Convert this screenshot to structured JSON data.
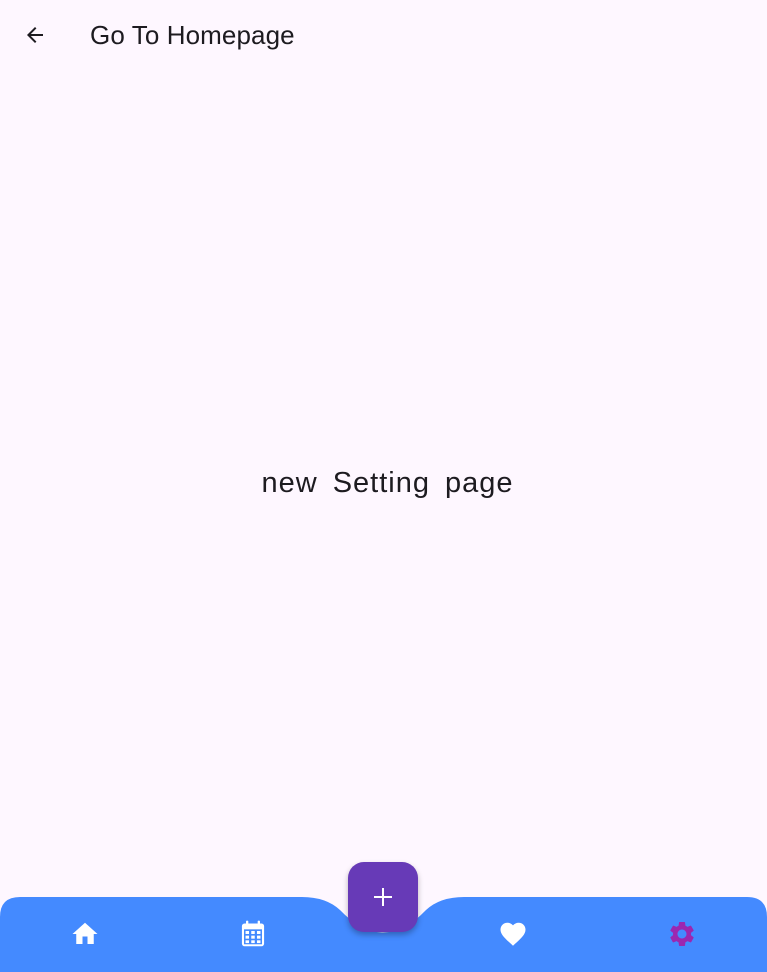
{
  "app_bar": {
    "title": "Go To Homepage",
    "back_icon": "arrow-back-icon"
  },
  "main": {
    "text": "new Setting page"
  },
  "fab": {
    "icon": "plus-icon",
    "color": "#673ab7"
  },
  "bottom_nav": {
    "background": "#448aff",
    "active_color": "#9c27b0",
    "inactive_color": "#ffffff",
    "items": [
      {
        "icon": "home-icon",
        "active": false
      },
      {
        "icon": "calendar-icon",
        "active": false
      },
      {
        "icon": "heart-icon",
        "active": false
      },
      {
        "icon": "gear-icon",
        "active": true
      }
    ]
  }
}
